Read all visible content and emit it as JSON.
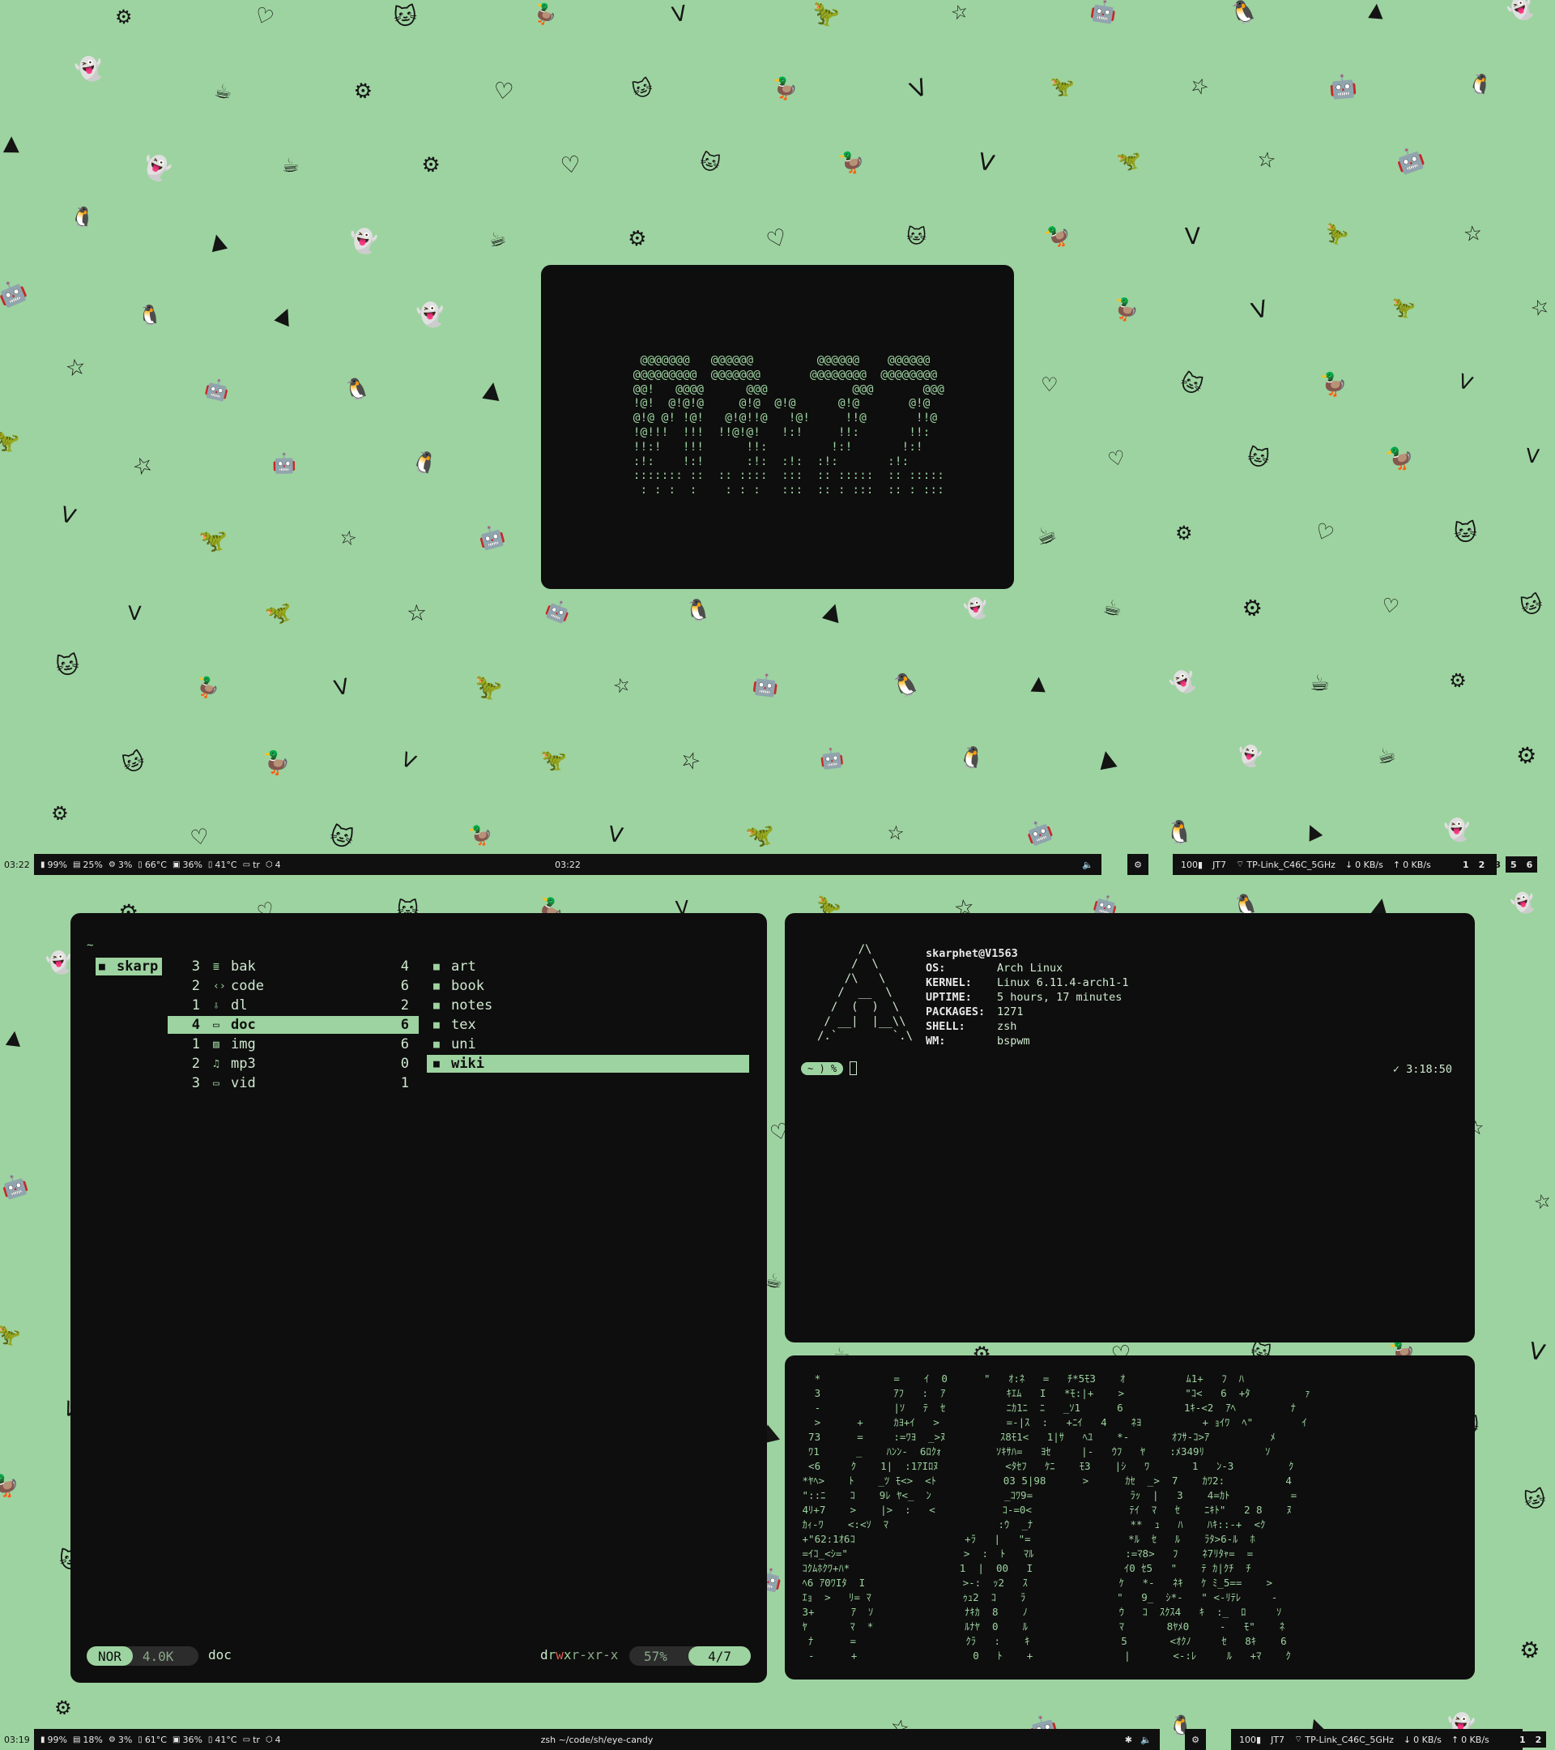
{
  "wallpaper": {
    "icons": [
      {
        "glyph": "☕",
        "name": "coffee-icon"
      },
      {
        "glyph": "☆",
        "name": "star-icon"
      },
      {
        "glyph": "♡",
        "name": "heart-icon"
      },
      {
        "glyph": "🐧",
        "name": "tux-icon"
      },
      {
        "glyph": "🦆",
        "name": "duck-icon"
      },
      {
        "glyph": "👻",
        "name": "ghost-icon"
      },
      {
        "glyph": "🦖",
        "name": "dino-icon"
      },
      {
        "glyph": "⚙",
        "name": "chip-icon"
      },
      {
        "glyph": "🤖",
        "name": "robot-icon"
      },
      {
        "glyph": "🐱",
        "name": "cat-icon"
      },
      {
        "glyph": "▲",
        "name": "arch-icon"
      },
      {
        "glyph": "V",
        "name": "vim-icon"
      }
    ]
  },
  "clock": {
    "art": "  @@@@@@@   @@@@@@         @@@@@@    @@@@@@\n @@@@@@@@@  @@@@@@@       @@@@@@@@  @@@@@@@@\n @@!   @@@@      @@@            @@@       @@@\n !@!  @!@!@     @!@  @!@      @!@       @!@\n @!@ @! !@!   @!@!!@   !@!     !!@       !!@\n !@!!!  !!!  !!@!@!   !:!     !!:       !!:\n !!:!   !!!      !!:         !:!       !:!\n :!:    !:!      :!:  :!:  :!:       :!:\n ::::::: ::  :: ::::  :::  :: :::::  :: :::::\n  : : :  :    : : :   :::  :: : :::  :: : :::"
  },
  "ranger": {
    "path": "~",
    "parent": "skarp",
    "middle": [
      {
        "num": "3",
        "icon": "≣",
        "name": "bak",
        "count": "4"
      },
      {
        "num": "2",
        "icon": "‹›",
        "name": "code",
        "count": "6"
      },
      {
        "num": "1",
        "icon": "⇩",
        "name": "dl",
        "count": "2"
      },
      {
        "num": "4",
        "icon": "▭",
        "name": "doc",
        "count": "6"
      },
      {
        "num": "1",
        "icon": "▨",
        "name": "img",
        "count": "6"
      },
      {
        "num": "2",
        "icon": "♫",
        "name": "mp3",
        "count": "0"
      },
      {
        "num": "3",
        "icon": "▭",
        "name": "vid",
        "count": "1"
      }
    ],
    "right": [
      "art",
      "book",
      "notes",
      "tex",
      "uni",
      "wiki"
    ],
    "status": {
      "mode": "NOR",
      "size": "4.0K",
      "name": "doc",
      "perm_d": "d",
      "perm_r1": "r",
      "perm_w1": "w",
      "perm_x1": "x",
      "perm_rest": "r-xr-x",
      "percent": "57%",
      "position": "4/7"
    }
  },
  "fetch": {
    "logo": "      /\\\n     /  \\\n    /\\   \\\n   /  __  \\\n  /  (  )  \\\n / __|  |__\\\\\n/.`        `.\\",
    "user": "skarphet@V1563",
    "rows": [
      {
        "key": "OS:",
        "value": "Arch Linux"
      },
      {
        "key": "KERNEL:",
        "value": "Linux 6.11.4-arch1-1"
      },
      {
        "key": "UPTIME:",
        "value": "5 hours, 17 minutes"
      },
      {
        "key": "PACKAGES:",
        "value": "1271"
      },
      {
        "key": "SHELL:",
        "value": "zsh"
      },
      {
        "key": "WM:",
        "value": "bspwm"
      }
    ],
    "prompt": "~ ) %",
    "timer": "✓ 3:18:50"
  },
  "matrix": {
    "art": "   *            =    ｲ  0      \"   ｵ:ﾈ   =   ﾁ*5ﾓ3    ｵ          ﾑ1+   ﾌ  ﾊ\n   3            ｱﾌ   :  ｱ          ｷｴﾑ   I   *ﾓ:|+    >          \"ｺ<   6  +ﾀ         ｧ\n   -            |ｿ   ﾃ  ｾ          ﾆｶ1ﾆ  ﾆ   _ｿ1      6          1ｷ-<2  ｱﾍ         ﾅ\n   >      +     ｶﾖ+ｲ   >           =-|ｽ  :   +ﾆｲ   4    ﾈﾖ          + ｮｲﾜ  ﾍ\"        ｲ\n  73      =     :=ﾜﾖ  _>ﾇ         ｽ8ﾓ1<   1|ｻ   ﾍﾕ    *-       ｵﾌｻ-ｺ>ｱ          ﾒ\n  ﾜ1      _    ﾊﾝﾝ-  6ﾛｸｫ         ｿｷｻﾊ=   ﾖｾ     |-   ｳﾌ   ﾔ    :ﾒ349ﾘ          ｿ\n  <6     ｸ    1|  :1ｱIﾛﾇ           <ﾀｾﾌ   ｹﾆ    ﾓ3    |ｼ   ﾜ       1   ﾝ-3         ｸ\n *ﾔﾍ>    ﾄ    _ﾂ ﾓ<>  <ﾄ           03 5|98      >      ｶｾ  _>  7    ｶﾜ2:          4\n \"::ﾆ    ｺ    9ﾚ ﾔ<_  ﾝ            _ｺﾜ9=                ﾗｯ  |   3    4=ｶﾄ          =\n 4ﾘ+7    >    |>  :   <           ｺ-=0<                ﾃｲ  ﾏ   ｾ    ﾆｷﾄ\"   2 8    ﾇ\n ｶｨ-ﾜ    <:<ｿ  ﾏ                  :ｳ  _ﾅ                **  ｭ   ﾊ    ﾊｷ::-+  <ｸ\n +\"62:1ｵ6ｺ                  +ﾗ   |   \"=                *ﾙ  ｾ   ﾙ    ﾗﾀ>6-ﾙ  ﾎ\n =ｲｺ_<ｼ=\"                   >  :  ﾄ   ﾏﾙ               :=ﾏ8>   ﾌ    ﾈ7ﾘﾀｬ=  =\n ｺｸﾑﾎｸﾜ+ﾊ*                  1  |  00   I               ｲ0 ｾ5   \"    ﾃ ｶ|ｸﾁ  ﾁ\n ﾍ6 ｱ0ﾜIﾀ  I                >-:  ｯ2   ｽ               ｹ   *-   ﾈｷ   ｹ ﾐ_5==    >\n ｴｮ  >   ﾘ= ﾏ               ｩｭ2  ｺ    ﾗ               \"   9_  ｼ*-   \" <-ﾘﾃﾚ     -\n 3+      ｱ  ｿ               ﾅｷｶ  8    ﾉ               ｳ   ｺ  ｽｸｽ4   ｷ  :_  ﾛ     ｿ\n ﾔ       ﾏ  *               ﾙﾅﾔ  0    ﾙ               ﾏ       8ﾔﾒ0     -   ﾓ\"    ﾈ\n  ﾅ      =                  ｸﾗ   :    ｷ               5       <ｵｸﾉ     ｾ   8ｷ    6\n  -      +                   0   ﾄ    +               |       <-:ﾚ     ﾙ   +ﾏ    ｸ"
  },
  "top_bar": {
    "time_left": "03:22",
    "stats": [
      {
        "icon": "▮",
        "name": "battery",
        "text": "99%"
      },
      {
        "icon": "▤",
        "name": "memory",
        "text": "25%"
      },
      {
        "icon": "⚙",
        "name": "cpu",
        "text": "3%"
      },
      {
        "icon": "▯",
        "name": "cpu-temp",
        "text": "66°C"
      },
      {
        "icon": "▣",
        "name": "disk",
        "text": "36%"
      },
      {
        "icon": "▯",
        "name": "gpu-temp",
        "text": "41°C"
      },
      {
        "icon": "▭",
        "name": "keyboard",
        "text": "tr"
      },
      {
        "icon": "⬡",
        "name": "updates",
        "text": "4"
      }
    ],
    "center": "03:22",
    "volume_icon": "🔈",
    "settings_icon": "⚙",
    "net": [
      {
        "icon": "",
        "name": "battery",
        "text": "100▮"
      },
      {
        "icon": "",
        "name": "device",
        "text": "JT7"
      },
      {
        "icon": "⌔",
        "name": "wifi",
        "text": "TP-Link_C46C_5GHz"
      },
      {
        "icon": "↓",
        "name": "down",
        "text": "0 KB/s"
      },
      {
        "icon": "↑",
        "name": "up",
        "text": "0 KB/s"
      }
    ],
    "workspaces": [
      "1",
      "2",
      "3",
      "5",
      "6"
    ],
    "active_ws": [
      "1",
      "2",
      "5",
      "6"
    ]
  },
  "bottom_bar": {
    "time_left": "03:19",
    "stats": [
      {
        "icon": "▮",
        "name": "battery",
        "text": "99%"
      },
      {
        "icon": "▤",
        "name": "memory",
        "text": "18%"
      },
      {
        "icon": "⚙",
        "name": "cpu",
        "text": "3%"
      },
      {
        "icon": "▯",
        "name": "cpu-temp",
        "text": "61°C"
      },
      {
        "icon": "▣",
        "name": "disk",
        "text": "36%"
      },
      {
        "icon": "▯",
        "name": "gpu-temp",
        "text": "41°C"
      },
      {
        "icon": "▭",
        "name": "keyboard",
        "text": "tr"
      },
      {
        "icon": "⬡",
        "name": "updates",
        "text": "4"
      }
    ],
    "center": "zsh ~/code/sh/eye-candy",
    "bt_icon": "✱",
    "volume_icon": "🔈",
    "settings_icon": "⚙",
    "net": [
      {
        "icon": "",
        "name": "battery",
        "text": "100▮"
      },
      {
        "icon": "",
        "name": "device",
        "text": "JT7"
      },
      {
        "icon": "⌔",
        "name": "wifi",
        "text": "TP-Link_C46C_5GHz"
      },
      {
        "icon": "↓",
        "name": "down",
        "text": "0 KB/s"
      },
      {
        "icon": "↑",
        "name": "up",
        "text": "0 KB/s"
      }
    ],
    "workspaces": [
      "1",
      "2"
    ]
  }
}
